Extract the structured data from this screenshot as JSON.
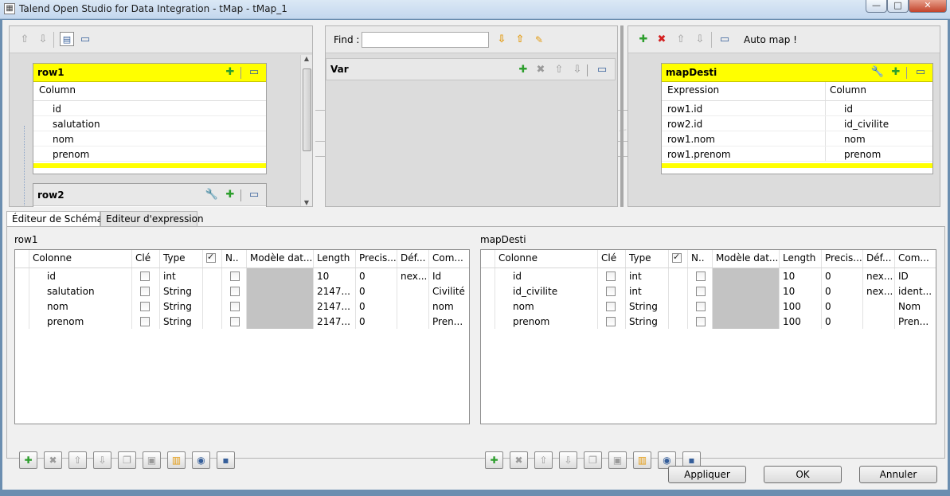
{
  "window": {
    "title": "Talend Open Studio for Data Integration - tMap - tMap_1",
    "min": "—",
    "max": "□",
    "close": "✕"
  },
  "left_panel": {
    "toolbar_icons": [
      "up-arrow-icon",
      "down-arrow-icon",
      "table-view-icon",
      "minimize-icon"
    ],
    "row1": {
      "name": "row1",
      "column_header": "Column",
      "columns": [
        "id",
        "salutation",
        "nom",
        "prenom"
      ]
    },
    "row2": {
      "name": "row2"
    }
  },
  "middle_panel": {
    "find_label": "Find :",
    "find_value": "",
    "var": {
      "name": "Var"
    }
  },
  "right_panel": {
    "automap_label": "Auto map !",
    "output": {
      "name": "mapDesti",
      "headers": [
        "Expression",
        "Column"
      ],
      "rows": [
        {
          "expression": "row1.id",
          "column": "id"
        },
        {
          "expression": "row2.id",
          "column": "id_civilite"
        },
        {
          "expression": "row1.nom",
          "column": "nom"
        },
        {
          "expression": "row1.prenom",
          "column": "prenom"
        }
      ]
    }
  },
  "tabs": {
    "schema_editor": "Éditeur de  Schéma",
    "expression_editor": "Editeur d'expression"
  },
  "schema_left": {
    "title": "row1",
    "headers": [
      "Colonne",
      "Clé",
      "Type",
      "",
      "N..",
      "Modèle dat...",
      "Length",
      "Precis...",
      "Déf...",
      "Com..."
    ],
    "rows": [
      {
        "colonne": "id",
        "type": "int",
        "length": "10",
        "precision": "0",
        "default": "nex...",
        "comment": "Id"
      },
      {
        "colonne": "salutation",
        "type": "String",
        "length": "2147...",
        "precision": "0",
        "default": "",
        "comment": "Civilité"
      },
      {
        "colonne": "nom",
        "type": "String",
        "length": "2147...",
        "precision": "0",
        "default": "",
        "comment": "nom"
      },
      {
        "colonne": "prenom",
        "type": "String",
        "length": "2147...",
        "precision": "0",
        "default": "",
        "comment": "Pren..."
      }
    ]
  },
  "schema_right": {
    "title": "mapDesti",
    "headers": [
      "Colonne",
      "Clé",
      "Type",
      "",
      "N..",
      "Modèle dat...",
      "Length",
      "Precis...",
      "Déf...",
      "Com..."
    ],
    "rows": [
      {
        "colonne": "id",
        "type": "int",
        "length": "10",
        "precision": "0",
        "default": "nex...",
        "comment": "ID"
      },
      {
        "colonne": "id_civilite",
        "type": "int",
        "length": "10",
        "precision": "0",
        "default": "nex...",
        "comment": "ident..."
      },
      {
        "colonne": "nom",
        "type": "String",
        "length": "100",
        "precision": "0",
        "default": "",
        "comment": "Nom"
      },
      {
        "colonne": "prenom",
        "type": "String",
        "length": "100",
        "precision": "0",
        "default": "",
        "comment": "Pren..."
      }
    ]
  },
  "buttons": {
    "apply": "Appliquer",
    "ok": "OK",
    "cancel": "Annuler"
  },
  "colors": {
    "table_header_yellow": "#ffff00",
    "panel_gray": "#dcdcdc"
  }
}
